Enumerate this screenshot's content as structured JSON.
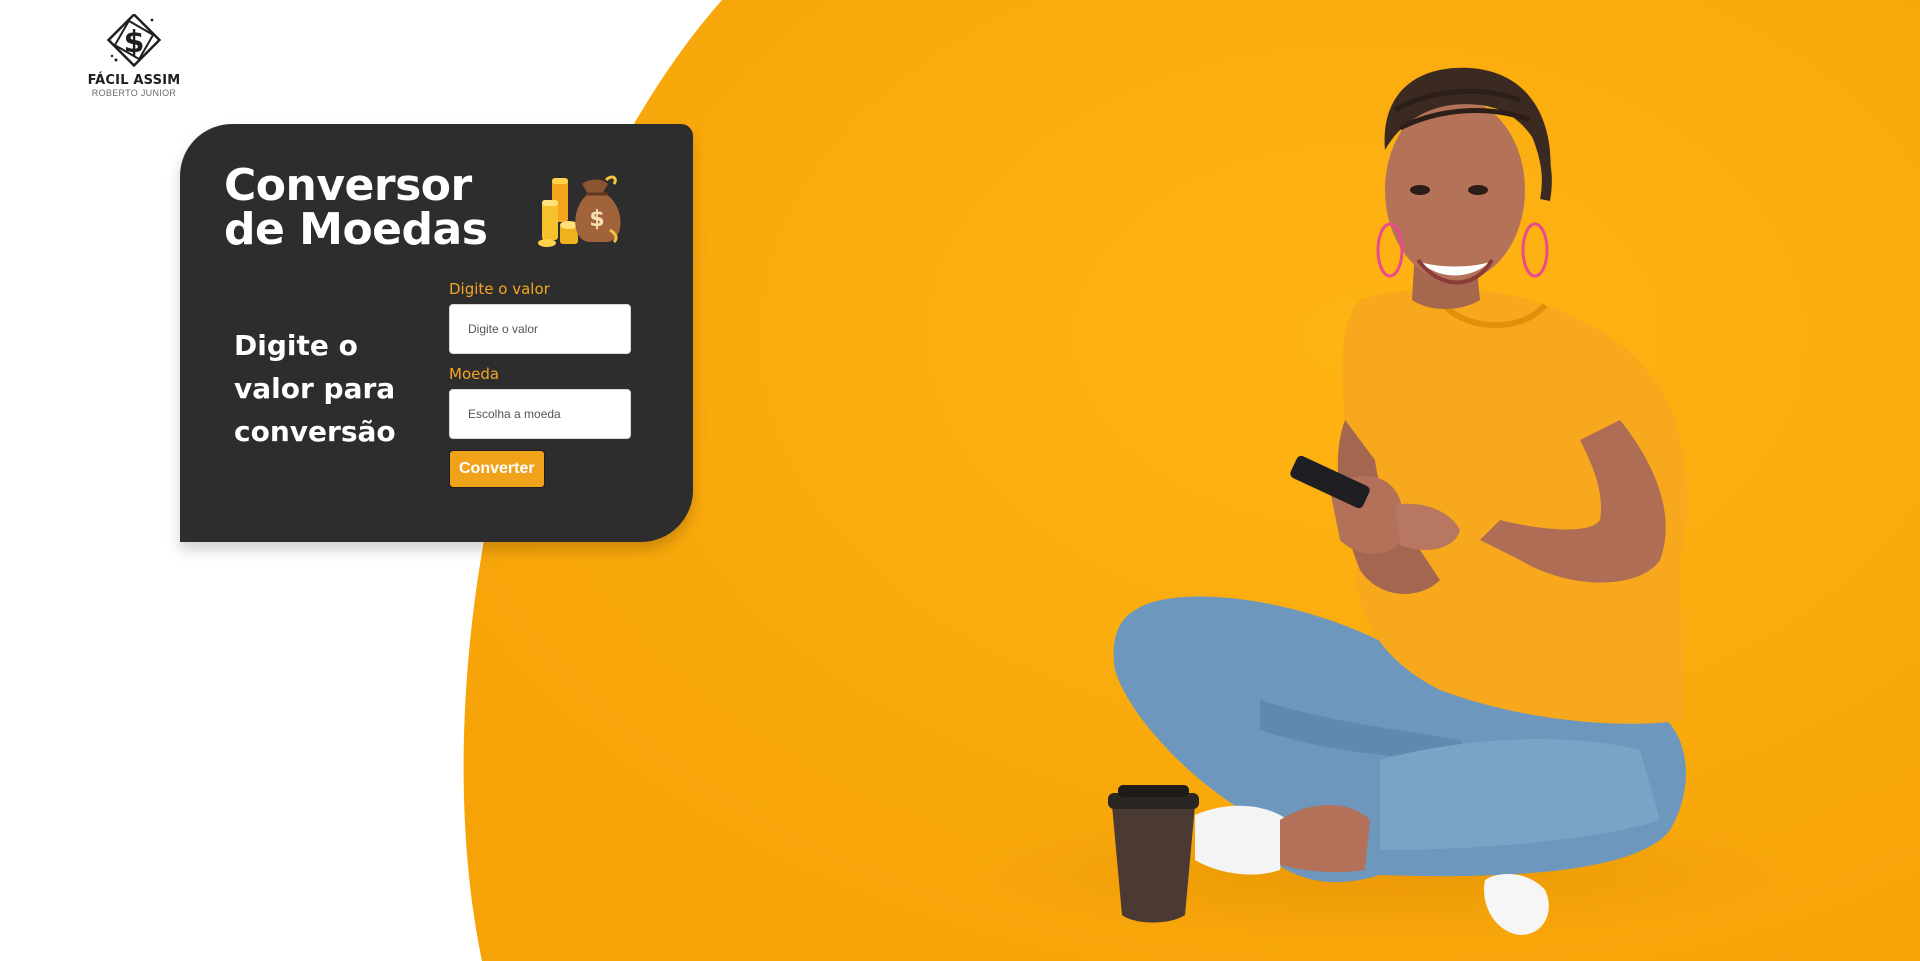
{
  "brand": {
    "name": "FÁCIL ASSIM",
    "subtitle": "ROBERTO JUNIOR",
    "logo_icon": "dollar-diamond-icon"
  },
  "card": {
    "title": "Conversor de Moedas",
    "icon": "money-bag-coins-icon",
    "side_text": "Digite o valor para conversão"
  },
  "form": {
    "amount_label": "Digite o valor",
    "amount_placeholder": "Digite o valor",
    "amount_value": "",
    "currency_label": "Moeda",
    "currency_placeholder": "Escolha a moeda",
    "currency_value": "",
    "convert_label": "Converter"
  },
  "hero": {
    "image": "smiling-woman-with-phone-and-coffee"
  },
  "colors": {
    "accent": "#f4a623",
    "hero_orange": "#fba90e",
    "card_bg": "#2d2d2d",
    "button": "#f0a31a"
  }
}
